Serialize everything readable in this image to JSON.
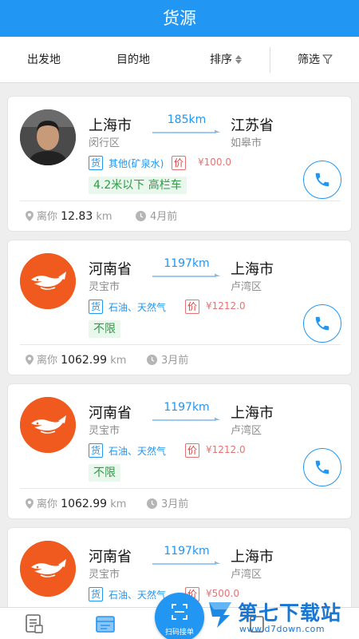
{
  "header": {
    "title": "货源"
  },
  "filters": {
    "from": "出发地",
    "to": "目的地",
    "sort": "排序",
    "filter": "筛选"
  },
  "colors": {
    "primary": "#2196f3",
    "price": "#e57373",
    "truck_tag_bg": "#e9f7ec",
    "truck_tag_text": "#2e9b47",
    "logo_orange": "#f05a1e"
  },
  "cards": [
    {
      "avatar": "person-photo",
      "origin": "上海市",
      "origin_sub": "闵行区",
      "distance": "185km",
      "dest": "江苏省",
      "dest_sub": "如皋市",
      "goods_tag": "货",
      "goods": "其他(矿泉水)",
      "price_tag": "价",
      "price": "¥100.0",
      "truck": "4.2米以下 高栏车",
      "away_label": "离你",
      "away_value": "12.83",
      "away_unit": "km",
      "time": "4月前"
    },
    {
      "avatar": "orange-logo",
      "origin": "河南省",
      "origin_sub": "灵宝市",
      "distance": "1197km",
      "dest": "上海市",
      "dest_sub": "卢湾区",
      "goods_tag": "货",
      "goods": "石油、天然气",
      "price_tag": "价",
      "price": "¥1212.0",
      "truck": "不限",
      "away_label": "离你",
      "away_value": "1062.99",
      "away_unit": "km",
      "time": "3月前"
    },
    {
      "avatar": "orange-logo",
      "origin": "河南省",
      "origin_sub": "灵宝市",
      "distance": "1197km",
      "dest": "上海市",
      "dest_sub": "卢湾区",
      "goods_tag": "货",
      "goods": "石油、天然气",
      "price_tag": "价",
      "price": "¥1212.0",
      "truck": "不限",
      "away_label": "离你",
      "away_value": "1062.99",
      "away_unit": "km",
      "time": "3月前"
    },
    {
      "avatar": "orange-logo",
      "origin": "河南省",
      "origin_sub": "灵宝市",
      "distance": "1197km",
      "dest": "上海市",
      "dest_sub": "卢湾区",
      "goods_tag": "货",
      "goods": "石油、天然气",
      "price_tag": "价",
      "price": "¥500.0"
    }
  ],
  "bottom_nav": {
    "scan_label": "扫码接单"
  },
  "watermark": {
    "title": "第七下载站",
    "url": "www.d7down.com"
  }
}
